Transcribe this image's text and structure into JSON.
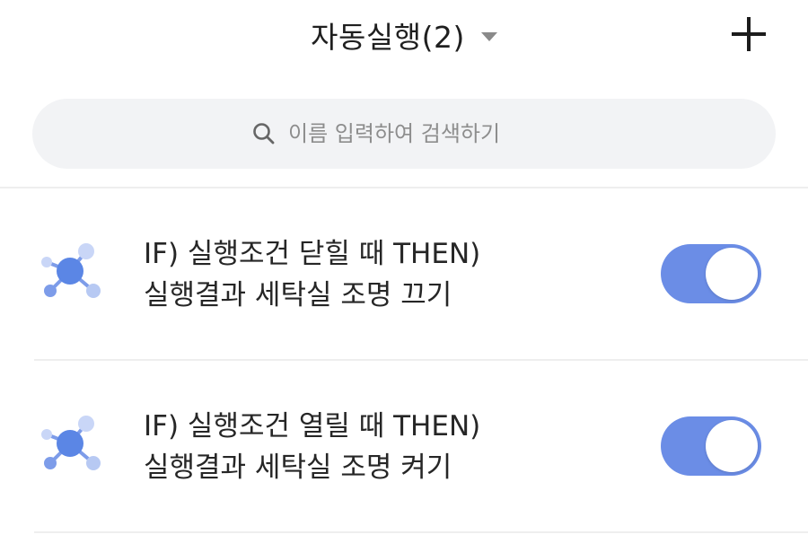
{
  "header": {
    "title": "자동실행(2)",
    "dropdown_icon": "caret-down-icon",
    "add_icon": "plus-icon"
  },
  "search": {
    "placeholder": "이름 입력하여 검색하기",
    "value": "",
    "icon": "search-icon"
  },
  "automations": [
    {
      "line1": "IF) 실행조건 닫힐 때 THEN)",
      "line2": "실행결과 세탁실 조명 끄기",
      "enabled": true,
      "icon": "automation-node-icon"
    },
    {
      "line1": "IF) 실행조건 열릴 때 THEN)",
      "line2": "실행결과 세탁실 조명 켜기",
      "enabled": true,
      "icon": "automation-node-icon"
    }
  ],
  "colors": {
    "accent": "#6b8de6",
    "node_main": "#5b86e5",
    "node_light": "#c9d6f7",
    "search_bg": "#f2f3f5",
    "divider": "#eeeeee"
  }
}
